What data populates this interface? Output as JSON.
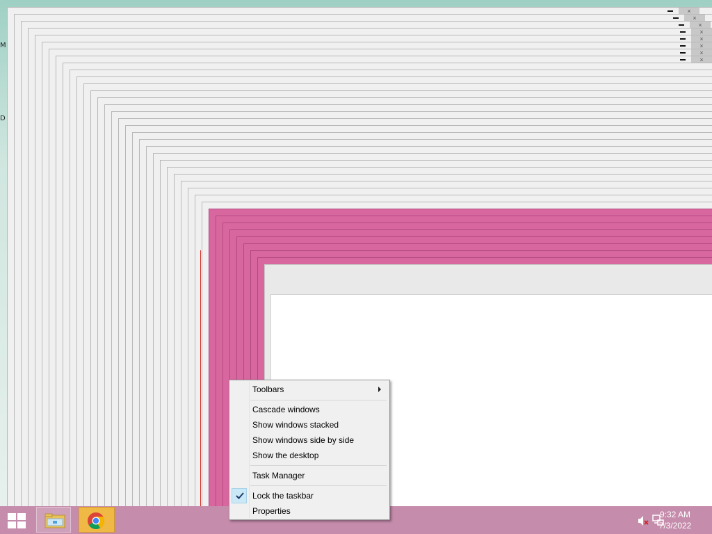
{
  "desktop": {
    "icon_stub_1": "M",
    "icon_stub_2": "D"
  },
  "taskbar": {
    "start_icon": "windows-logo-icon",
    "pinned": [
      {
        "name": "File Explorer",
        "icon": "folder-icon"
      },
      {
        "name": "Google Chrome",
        "icon": "chrome-icon",
        "active": true
      }
    ],
    "tray": {
      "volume_icon": "volume-muted-icon",
      "network_icon": "network-icon",
      "time": "9:32 AM",
      "date": "7/3/2022"
    }
  },
  "context_menu": {
    "toolbars": "Toolbars",
    "cascade": "Cascade windows",
    "stacked": "Show windows stacked",
    "side_by_side": "Show windows side by side",
    "show_desktop": "Show the desktop",
    "task_manager": "Task Manager",
    "lock_taskbar": "Lock the taskbar",
    "lock_taskbar_checked": true,
    "properties": "Properties"
  },
  "window_controls": {
    "close_symbol": "×"
  },
  "colors": {
    "taskbar": "#c58cab",
    "pink_window": "#d9679f",
    "gray_window": "#f0f0f0",
    "chrome_highlight": "#f0b844",
    "menu_check_highlight": "#cbe8f6"
  }
}
